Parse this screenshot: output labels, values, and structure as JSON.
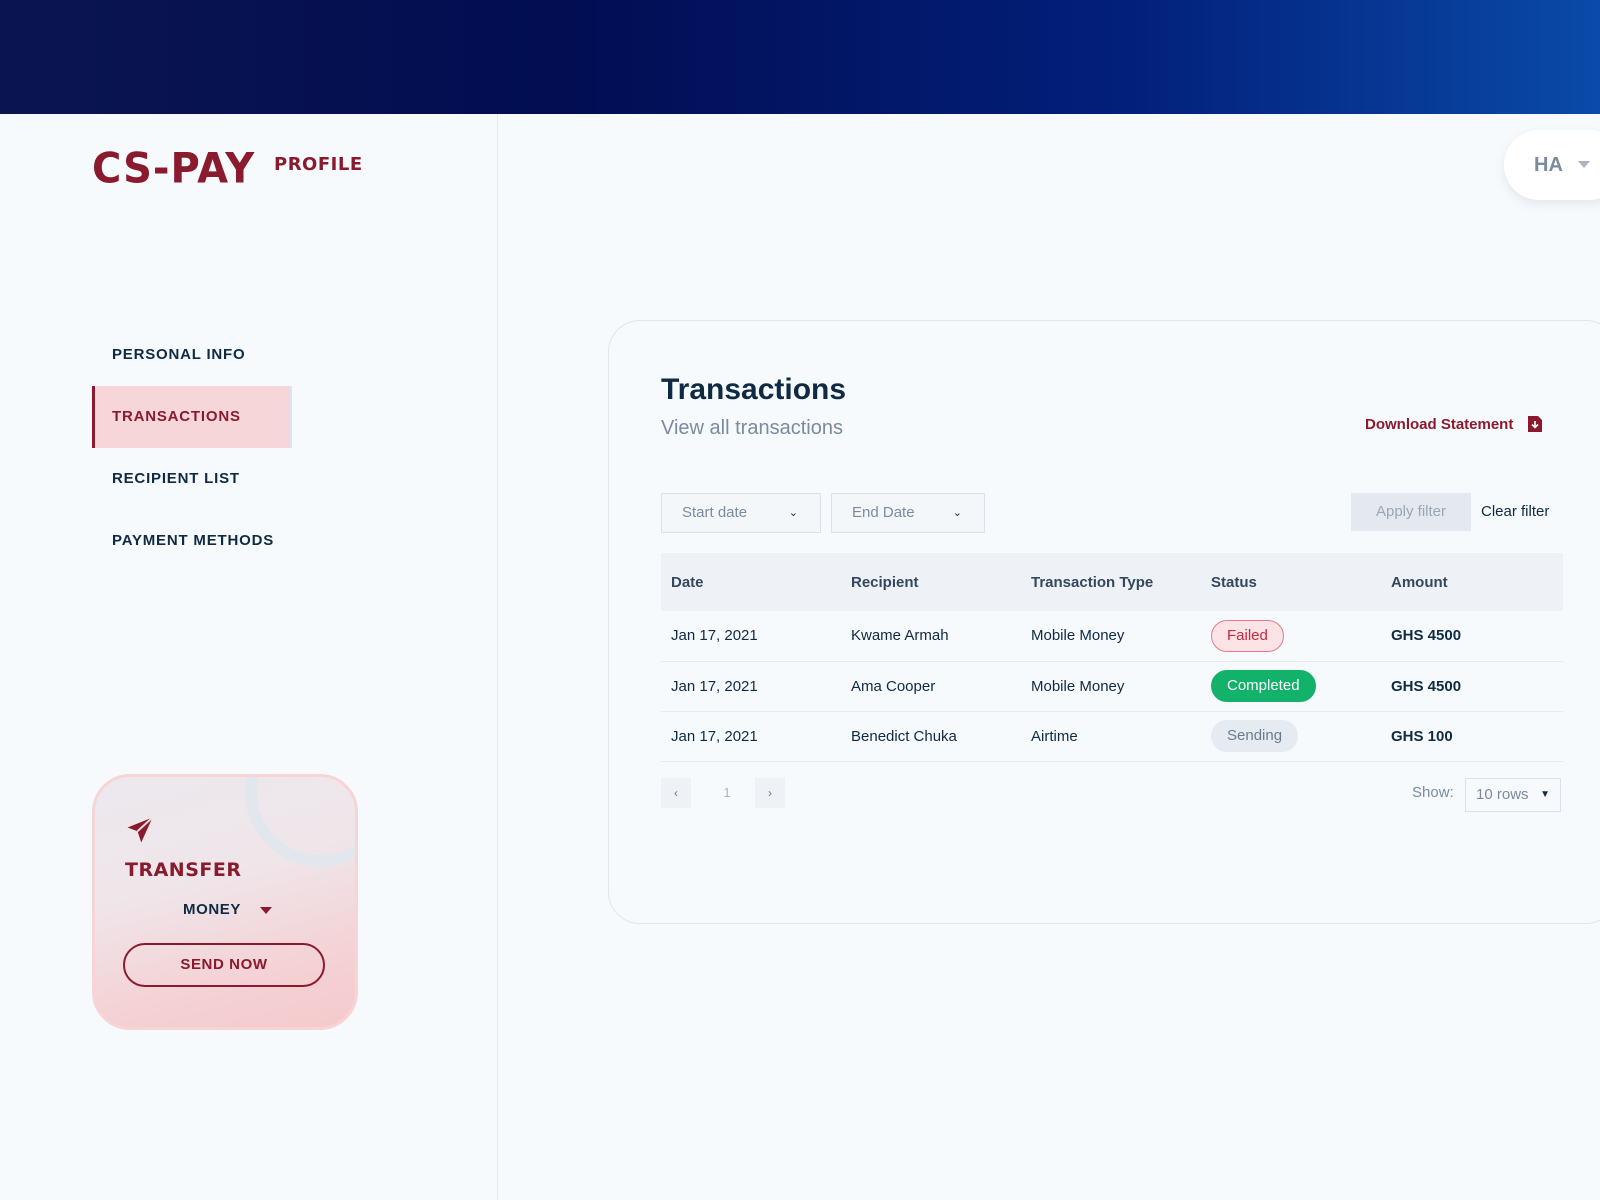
{
  "brand": {
    "logo": "CS-PAY",
    "section": "PROFILE"
  },
  "user": {
    "initials": "HA"
  },
  "sidebar": {
    "items": [
      {
        "label": "PERSONAL INFO"
      },
      {
        "label": "TRANSACTIONS"
      },
      {
        "label": "RECIPIENT LIST"
      },
      {
        "label": "PAYMENT METHODS"
      }
    ],
    "active_index": 1
  },
  "transfer_card": {
    "title": "TRANSFER",
    "subtitle": "MONEY",
    "button": "SEND NOW"
  },
  "transactions": {
    "title": "Transactions",
    "subtitle": "View all transactions",
    "download_label": "Download Statement",
    "filters": {
      "start_date": "Start date",
      "end_date": "End Date",
      "apply": "Apply filter",
      "clear": "Clear filter"
    },
    "columns": [
      "Date",
      "Recipient",
      "Transaction Type",
      "Status",
      "Amount"
    ],
    "rows": [
      {
        "date": "Jan 17, 2021",
        "recipient": "Kwame Armah",
        "type": "Mobile Money",
        "status": "Failed",
        "amount": "GHS 4500"
      },
      {
        "date": "Jan 17, 2021",
        "recipient": "Ama Cooper",
        "type": "Mobile Money",
        "status": "Completed",
        "amount": "GHS 4500"
      },
      {
        "date": "Jan 17, 2021",
        "recipient": "Benedict Chuka",
        "type": "Airtime",
        "status": "Sending",
        "amount": "GHS 100"
      }
    ],
    "pagination": {
      "prev": "‹",
      "current_page": "1",
      "next": "›",
      "show_label": "Show:",
      "rows_option": "10 rows"
    }
  },
  "colors": {
    "brand_red": "#8a1a2e",
    "navy": "#0f2a44",
    "failed": "#c8283c",
    "completed": "#12b26a",
    "sending": "#6a7a8e"
  },
  "icons": {
    "send": "paper-plane-icon",
    "download": "file-download-icon",
    "chevron": "chevron-down-icon"
  }
}
